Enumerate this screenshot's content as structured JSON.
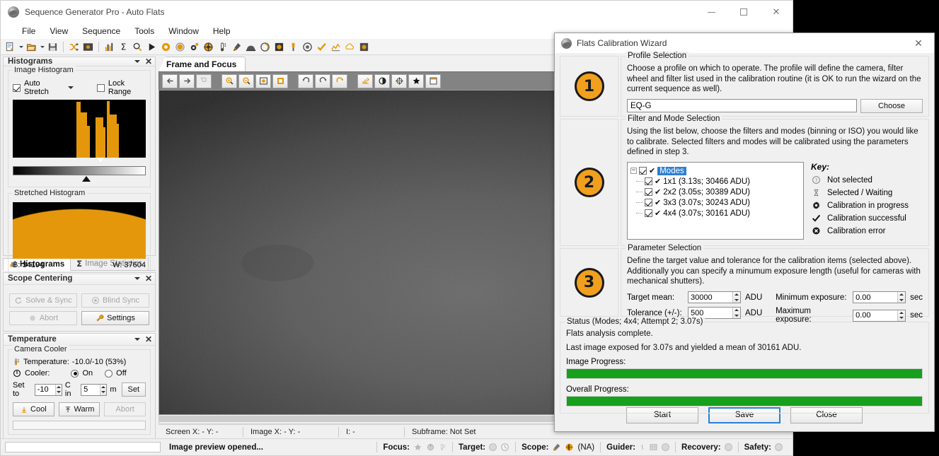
{
  "app": {
    "title": "Sequence Generator Pro - Auto Flats",
    "icon": "sgp-logo-icon",
    "window_controls": {
      "minimize": "minimize-icon",
      "maximize": "maximize-icon",
      "close": "close-icon"
    },
    "menus": [
      "File",
      "View",
      "Sequence",
      "Tools",
      "Window",
      "Help"
    ]
  },
  "toolbar": {
    "icons": [
      "new-sequence-icon",
      "new-dropdown-caret",
      "open-icon",
      "open-dropdown-caret",
      "save-icon",
      "shuffle-icon",
      "frame-focus-icon",
      "histogram-icon",
      "statistics-icon",
      "search-icon",
      "run-sequence-icon",
      "target-ring-icon",
      "filter-wheel-icon",
      "gear-settings-icon",
      "focus-target-icon",
      "thermometer-icon",
      "eyedropper-icon",
      "dome-icon",
      "rotator-icon",
      "flat-box-icon",
      "plug-icon",
      "guider-icon",
      "checkmark-icon",
      "graph-icon",
      "weather-icon",
      "notification-icon"
    ]
  },
  "histograms_panel": {
    "title": "Histograms",
    "image_histogram_label": "Image Histogram",
    "auto_stretch_label": "Auto Stretch",
    "auto_stretch_checked": true,
    "lock_range_label": "Lock Range",
    "lock_range_checked": false,
    "stretched_histogram_label": "Stretched Histogram",
    "black_point": "B: 34194",
    "white_point": "W: 37604",
    "collapse_icon": "chevron-down-icon",
    "close_icon": "close-icon",
    "tabs": [
      {
        "label": "Histograms",
        "icon": "histogram-icon",
        "active": true
      },
      {
        "label": "Image Statistics",
        "icon": "sigma-icon",
        "active": false
      }
    ]
  },
  "scope_centering_panel": {
    "title": "Scope Centering",
    "buttons": [
      {
        "label": "Solve & Sync",
        "icon": "solve-sync-icon",
        "disabled": true
      },
      {
        "label": "Blind Sync",
        "icon": "blind-sync-icon",
        "disabled": true
      },
      {
        "label": "Abort",
        "icon": "abort-icon",
        "disabled": true
      },
      {
        "label": "Settings",
        "icon": "wrench-icon",
        "disabled": false
      }
    ]
  },
  "temperature_panel": {
    "title": "Temperature",
    "group_label": "Camera Cooler",
    "temperature_label": "Temperature:",
    "temperature_value": "-10.0/-10 (53%)",
    "thermometer_icon": "thermometer-icon",
    "power_icon": "power-icon",
    "cooler_label": "Cooler:",
    "cooler_on_label": "On",
    "cooler_off_label": "Off",
    "cooler_state": "On",
    "set_to_label": "Set to",
    "set_to_value": "-10",
    "c_in_label": "C in",
    "c_in_value": "5",
    "minutes_label": "m",
    "set_button": "Set",
    "cool_button": "Cool",
    "warm_button": "Warm",
    "abort_button": "Abort"
  },
  "center": {
    "tab_label": "Frame and Focus",
    "view_toolbar_icons": [
      "arrow-left-icon",
      "arrow-right-icon",
      "flip-icon",
      "zoom-in-icon",
      "zoom-out-icon",
      "zoom-fit-icon",
      "zoom-actual-icon",
      "rotate-ccw-icon",
      "rotate-cw-icon",
      "refresh-icon",
      "stretch-icon",
      "contrast-icon",
      "crosshair-icon",
      "star-icon",
      "subframe-icon"
    ],
    "status": {
      "screen_xy": "Screen X: - Y: -",
      "image_xy": "Image X: - Y: -",
      "intensity": "I: -",
      "subframe": "Subframe: Not Set"
    }
  },
  "status_bar": {
    "message": "Image preview opened...",
    "groups": [
      {
        "label": "Focus:",
        "icons": [
          "star-icon",
          "focuser-icon",
          "temperature-probe-icon"
        ]
      },
      {
        "label": "Target:",
        "icons": [
          "target-dot-icon",
          "clock-icon"
        ]
      },
      {
        "label": "Scope:",
        "icons": [
          "telescope-icon",
          "globe-icon"
        ],
        "suffix": "(NA)"
      },
      {
        "label": "Guider:",
        "icons": [
          "guide-star-icon",
          "grid-icon",
          "guider-dot-icon"
        ]
      },
      {
        "label": "Recovery:",
        "icons": [
          "recovery-dot-icon"
        ]
      },
      {
        "label": "Safety:",
        "icons": [
          "safety-dot-icon"
        ]
      }
    ]
  },
  "wizard": {
    "title": "Flats Calibration Wizard",
    "icon": "sgp-logo-icon",
    "close_icon": "close-icon",
    "step1": {
      "badge": "1",
      "group_label": "Profile Selection",
      "description": "Choose a profile on which to operate.  The profile will define the camera, filter wheel and filter list used in the calibration routine (it is OK to run the wizard on the current sequence as well).",
      "profile_value": "EQ-G",
      "choose_button": "Choose"
    },
    "step2": {
      "badge": "2",
      "group_label": "Filter and Mode Selection",
      "description": "Using the list below, choose the filters and modes (binning or ISO) you would like to calibrate. Selected filters and modes will be calibrated using the parameters defined in step 3.",
      "tree_root": "Modes",
      "tree_items": [
        {
          "label": "1x1 (3.13s; 30466 ADU)",
          "checked": true,
          "status": "successful"
        },
        {
          "label": "2x2 (3.05s; 30389 ADU)",
          "checked": true,
          "status": "successful"
        },
        {
          "label": "3x3 (3.07s; 30243 ADU)",
          "checked": true,
          "status": "successful"
        },
        {
          "label": "4x4 (3.07s; 30161 ADU)",
          "checked": true,
          "status": "successful"
        }
      ],
      "key_title": "Key:",
      "key_items": [
        {
          "icon": "question-circle-icon",
          "label": "Not selected"
        },
        {
          "icon": "hourglass-icon",
          "label": "Selected / Waiting"
        },
        {
          "icon": "gear-icon",
          "label": "Calibration in progress"
        },
        {
          "icon": "check-icon",
          "label": "Calibration successful"
        },
        {
          "icon": "error-circle-icon",
          "label": "Calibration error"
        }
      ]
    },
    "step3": {
      "badge": "3",
      "group_label": "Parameter Selection",
      "description": "Define the target value and tolerance for the calibration items (selected above).  Additionally you can specify a minumum exposure length (useful for cameras with mechanical shutters).",
      "fields": [
        {
          "label": "Target mean:",
          "value": "30000",
          "unit": "ADU"
        },
        {
          "label": "Tolerance (+/-):",
          "value": "500",
          "unit": "ADU"
        },
        {
          "label": "Minimum exposure:",
          "value": "0.00",
          "unit": "sec"
        },
        {
          "label": "Maximum exposure:",
          "value": "0.00",
          "unit": "sec"
        }
      ]
    },
    "status": {
      "group_label": "Status (Modes; 4x4; Attempt 2; 3.07s)",
      "line1": "Flats analysis complete.",
      "line2": "Last image exposed for 3.07s and yielded a mean of 30161 ADU.",
      "image_progress_label": "Image Progress:",
      "image_progress_percent": 100,
      "overall_progress_label": "Overall Progress:",
      "overall_progress_percent": 100,
      "progress_color": "#17a01b"
    },
    "buttons": {
      "start": "Start",
      "save": "Save",
      "close": "Close"
    }
  }
}
